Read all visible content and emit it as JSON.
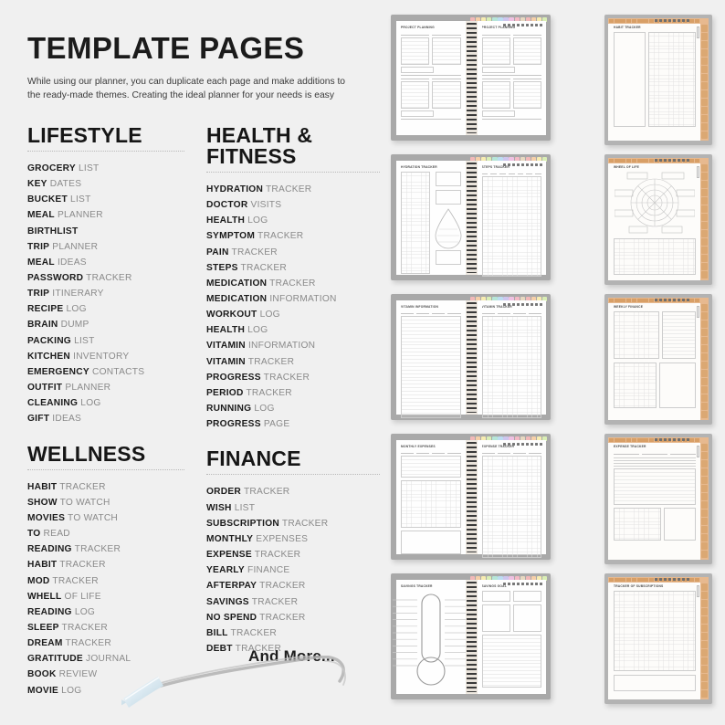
{
  "header": {
    "title": "TEMPLATE PAGES",
    "intro": "While using our planner, you can duplicate each page and make additions to the ready-made themes. Creating the ideal planner for your needs is easy"
  },
  "sections": [
    {
      "id": "lifestyle",
      "heading": "LIFESTYLE",
      "items": [
        {
          "bold": "GROCERY",
          "rest": "LIST"
        },
        {
          "bold": "KEY",
          "rest": "DATES"
        },
        {
          "bold": "BUCKET",
          "rest": "LIST"
        },
        {
          "bold": "MEAL",
          "rest": "PLANNER"
        },
        {
          "bold": "BIRTHLIST",
          "rest": ""
        },
        {
          "bold": "TRIP",
          "rest": "PLANNER"
        },
        {
          "bold": "MEAL",
          "rest": "IDEAS"
        },
        {
          "bold": "PASSWORD",
          "rest": "TRACKER"
        },
        {
          "bold": "TRIP",
          "rest": "ITINERARY"
        },
        {
          "bold": "RECIPE",
          "rest": "LOG"
        },
        {
          "bold": "BRAIN",
          "rest": "DUMP"
        },
        {
          "bold": "PACKING",
          "rest": "LIST"
        },
        {
          "bold": "KITCHEN",
          "rest": "INVENTORY"
        },
        {
          "bold": "EMERGENCY",
          "rest": "CONTACTS"
        },
        {
          "bold": "OUTFIT",
          "rest": "PLANNER"
        },
        {
          "bold": "CLEANING",
          "rest": "LOG"
        },
        {
          "bold": "GIFT",
          "rest": "IDEAS"
        }
      ]
    },
    {
      "id": "health",
      "heading": "HEALTH & FITNESS",
      "items": [
        {
          "bold": "HYDRATION",
          "rest": "TRACKER"
        },
        {
          "bold": "DOCTOR",
          "rest": "VISITS"
        },
        {
          "bold": "HEALTH",
          "rest": "LOG"
        },
        {
          "bold": "SYMPTOM",
          "rest": "TRACKER"
        },
        {
          "bold": "PAIN",
          "rest": "TRACKER"
        },
        {
          "bold": "STEPS",
          "rest": "TRACKER"
        },
        {
          "bold": "MEDICATION",
          "rest": "TRACKER"
        },
        {
          "bold": "MEDICATION",
          "rest": "INFORMATION"
        },
        {
          "bold": "WORKOUT",
          "rest": "LOG"
        },
        {
          "bold": "HEALTH",
          "rest": "LOG"
        },
        {
          "bold": "VITAMIN",
          "rest": "INFORMATION"
        },
        {
          "bold": "VITAMIN",
          "rest": "TRACKER"
        },
        {
          "bold": "PROGRESS",
          "rest": "TRACKER"
        },
        {
          "bold": "PERIOD",
          "rest": "TRACKER"
        },
        {
          "bold": "RUNNING",
          "rest": "LOG"
        },
        {
          "bold": "PROGRESS",
          "rest": "PAGE"
        }
      ]
    },
    {
      "id": "wellness",
      "heading": "WELLNESS",
      "items": [
        {
          "bold": "HABIT",
          "rest": "TRACKER"
        },
        {
          "bold": "SHOW",
          "rest": "TO WATCH"
        },
        {
          "bold": "MOVIES",
          "rest": "TO WATCH"
        },
        {
          "bold": "TO",
          "rest": "READ"
        },
        {
          "bold": "READING",
          "rest": "TRACKER"
        },
        {
          "bold": "HABIT",
          "rest": "TRACKER"
        },
        {
          "bold": "MOD",
          "rest": "TRACKER"
        },
        {
          "bold": "WHELL",
          "rest": "OF LIFE"
        },
        {
          "bold": "READING",
          "rest": "LOG"
        },
        {
          "bold": "SLEEP",
          "rest": "TRACKER"
        },
        {
          "bold": "DREAM",
          "rest": "TRACKER"
        },
        {
          "bold": "GRATITUDE",
          "rest": "JOURNAL"
        },
        {
          "bold": "BOOK",
          "rest": "REVIEW"
        },
        {
          "bold": "MOVIE",
          "rest": "LOG"
        }
      ]
    },
    {
      "id": "finance",
      "heading": "FINANCE",
      "items": [
        {
          "bold": "ORDER",
          "rest": "TRACKER"
        },
        {
          "bold": "WISH",
          "rest": "LIST"
        },
        {
          "bold": "SUBSCRIPTION",
          "rest": "TRACKER"
        },
        {
          "bold": "MONTHLY",
          "rest": "EXPENSES"
        },
        {
          "bold": "EXPENSE",
          "rest": "TRACKER"
        },
        {
          "bold": "YEARLY",
          "rest": "FINANCE"
        },
        {
          "bold": "AFTERPAY",
          "rest": "TRACKER"
        },
        {
          "bold": "SAVINGS",
          "rest": "TRACKER"
        },
        {
          "bold": "NO SPEND",
          "rest": "TRACKER"
        },
        {
          "bold": "BILL",
          "rest": "TRACKER"
        },
        {
          "bold": "DEBT",
          "rest": "TRACKER"
        }
      ]
    }
  ],
  "footer": {
    "and_more": "And More..."
  },
  "previews": {
    "tab_colors": [
      "#f2b8b8",
      "#f6cfa8",
      "#f7ecb0",
      "#d9eeb4",
      "#b6e6d8",
      "#bcdcf2",
      "#cdc6ee",
      "#efc0e2",
      "#f5b9c5",
      "#e8d8c0"
    ],
    "rows": [
      {
        "spread": {
          "left_title": "PROJECT PLANNING",
          "right_title": "PROJECT PLANNING",
          "layout": "project"
        },
        "portrait": {
          "title": "HABIT TRACKER",
          "layout": "habit"
        }
      },
      {
        "spread": {
          "left_title": "HYDRATION TRACKER",
          "right_title": "STEPS TRACKER",
          "layout": "hydration"
        },
        "portrait": {
          "title": "WHEEL OF LIFE",
          "layout": "wheel"
        }
      },
      {
        "spread": {
          "left_title": "VITAMIN INFORMATION",
          "right_title": "VITAMIN TRACKER",
          "layout": "vitamin"
        },
        "portrait": {
          "title": "WEEKLY FINANCE",
          "layout": "finance"
        }
      },
      {
        "spread": {
          "left_title": "MONTHLY EXPENSES",
          "right_title": "EXPENSE TRACKER",
          "layout": "expenses"
        },
        "portrait": {
          "title": "EXPENSE TRACKER",
          "layout": "expense-p"
        }
      },
      {
        "spread": {
          "left_title": "SAVINGS TRACKER",
          "right_title": "SAVINGS GOAL",
          "layout": "savings"
        },
        "portrait": {
          "title": "TRACKER OF SUBSCRIPTIONS",
          "layout": "subs"
        }
      }
    ]
  },
  "colors": {
    "background": "#f0f0f0",
    "text_bold": "#1b1b1b",
    "text_light": "#8a8a8a",
    "tab_accent": "#e7b98f"
  }
}
